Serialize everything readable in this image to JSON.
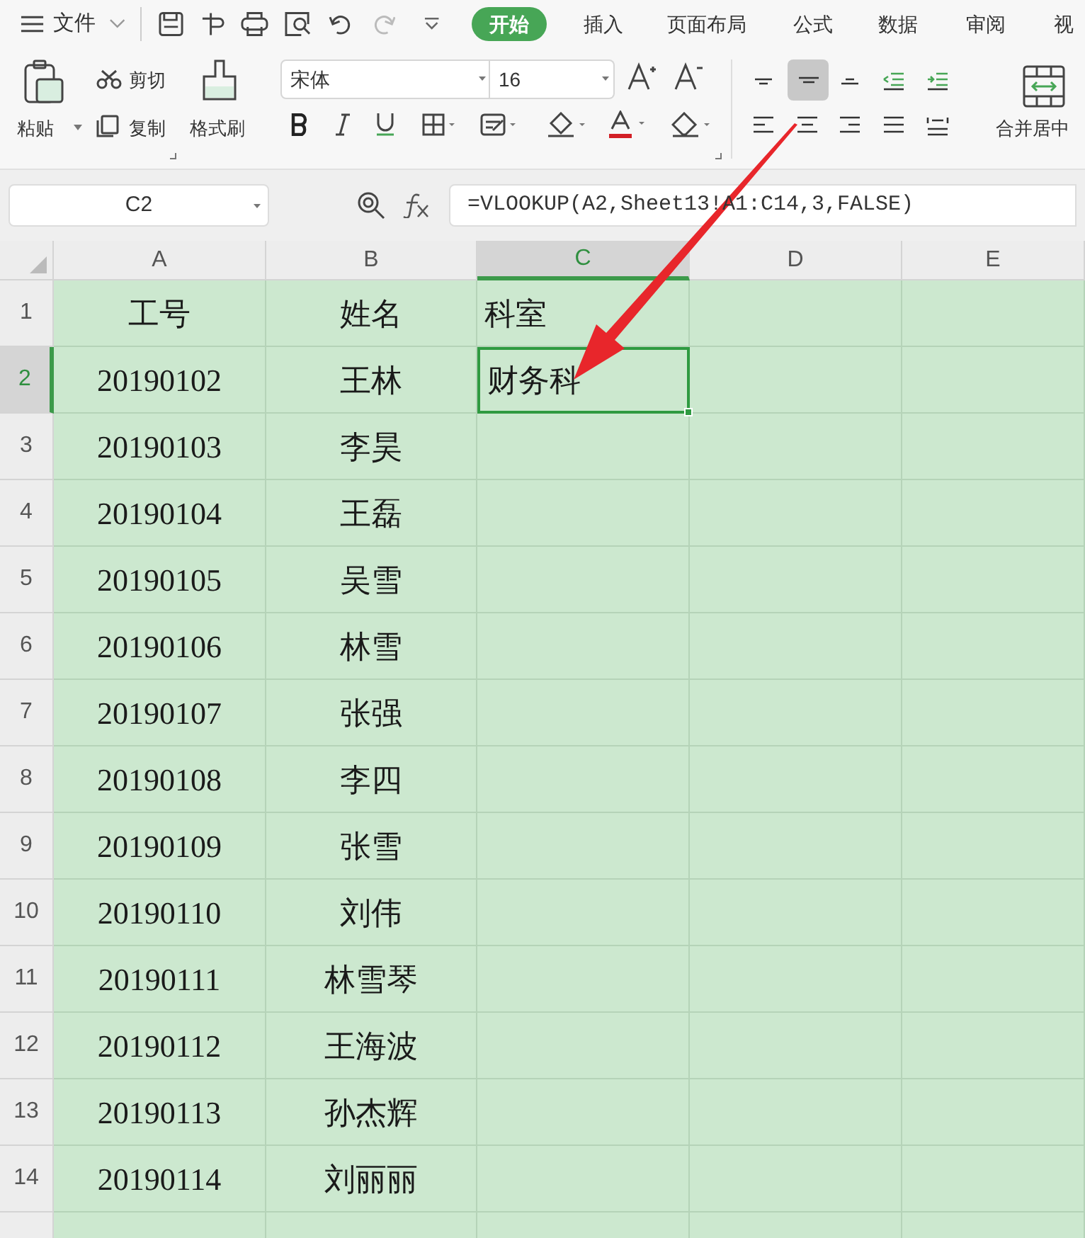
{
  "menu": {
    "label": "文件"
  },
  "tabs": [
    {
      "label": "开始",
      "selected": true
    },
    {
      "label": "插入",
      "selected": false
    },
    {
      "label": "页面布局",
      "selected": false
    },
    {
      "label": "公式",
      "selected": false
    },
    {
      "label": "数据",
      "selected": false
    },
    {
      "label": "审阅",
      "selected": false
    },
    {
      "label": "视",
      "selected": false
    }
  ],
  "clipboard": {
    "paste": "粘贴",
    "cut": "剪切",
    "copy": "复制",
    "format_painter": "格式刷"
  },
  "font": {
    "name": "宋体",
    "size": "16"
  },
  "alignment": [
    {
      "selected": false
    },
    {
      "selected": true
    },
    {
      "selected": false
    },
    {
      "selected": false
    },
    {
      "selected": false
    }
  ],
  "merge": {
    "label": "合并居中"
  },
  "name_box": "C2",
  "formula": "=VLOOKUP(A2,Sheet13!A1:C14,3,FALSE)",
  "columns": [
    {
      "label": "A",
      "selected": false
    },
    {
      "label": "B",
      "selected": false
    },
    {
      "label": "C",
      "selected": true
    },
    {
      "label": "D",
      "selected": false
    },
    {
      "label": "E",
      "selected": false
    }
  ],
  "rows": [
    {
      "number": "1",
      "selected": false,
      "cells": [
        "工号",
        "姓名",
        "科室"
      ]
    },
    {
      "number": "2",
      "selected": true,
      "cells": [
        "20190102",
        "王林",
        "财务科"
      ]
    },
    {
      "number": "3",
      "selected": false,
      "cells": [
        "20190103",
        "李昊"
      ]
    },
    {
      "number": "4",
      "selected": false,
      "cells": [
        "20190104",
        "王磊"
      ]
    },
    {
      "number": "5",
      "selected": false,
      "cells": [
        "20190105",
        "吴雪"
      ]
    },
    {
      "number": "6",
      "selected": false,
      "cells": [
        "20190106",
        "林雪"
      ]
    },
    {
      "number": "7",
      "selected": false,
      "cells": [
        "20190107",
        "张强"
      ]
    },
    {
      "number": "8",
      "selected": false,
      "cells": [
        "20190108",
        "李四"
      ]
    },
    {
      "number": "9",
      "selected": false,
      "cells": [
        "20190109",
        "张雪"
      ]
    },
    {
      "number": "10",
      "selected": false,
      "cells": [
        "20190110",
        "刘伟"
      ]
    },
    {
      "number": "11",
      "selected": false,
      "cells": [
        "20190111",
        "林雪琴"
      ]
    },
    {
      "number": "12",
      "selected": false,
      "cells": [
        "20190112",
        "王海波"
      ]
    },
    {
      "number": "13",
      "selected": false,
      "cells": [
        "20190113",
        "孙杰辉"
      ]
    },
    {
      "number": "14",
      "selected": false,
      "cells": [
        "20190114",
        "刘丽丽"
      ]
    }
  ]
}
